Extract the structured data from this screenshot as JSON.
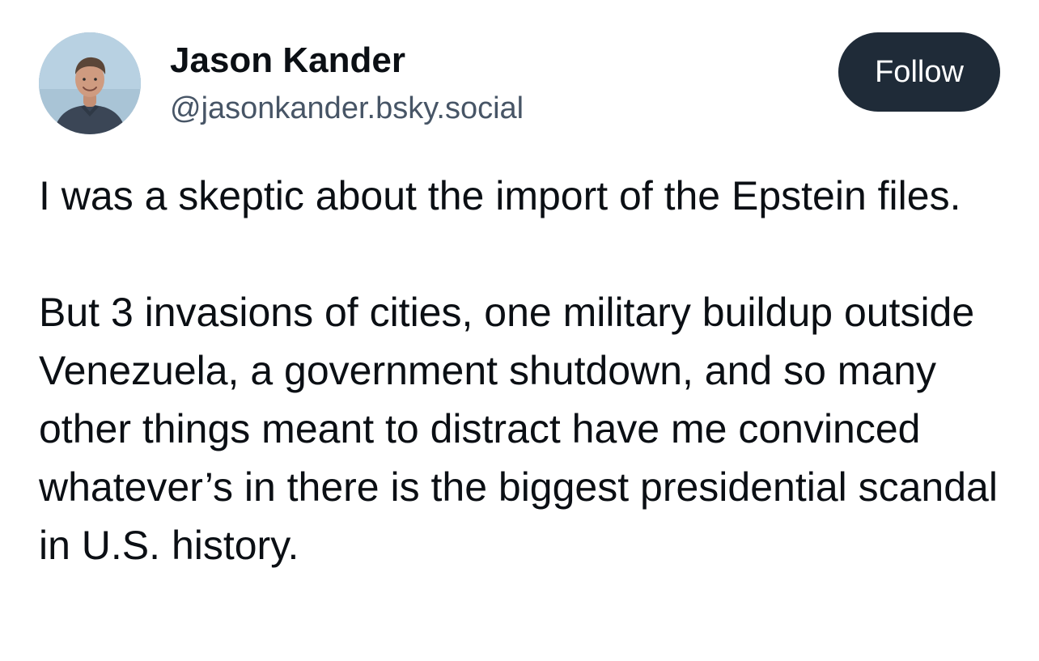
{
  "author": {
    "display_name": "Jason Kander",
    "handle": "@jasonkander.bsky.social"
  },
  "actions": {
    "follow_label": "Follow"
  },
  "post": {
    "paragraphs": [
      "I was a skeptic about the import of the Epstein files.",
      "But 3 invasions of cities, one military buildup outside Venezuela, a government shutdown, and so many other things meant to distract have me convinced whatever’s in there is the biggest presidential scandal in U.S. history."
    ]
  },
  "colors": {
    "follow_button_bg": "#1f2b38",
    "handle_text": "#475566",
    "body_text": "#0b0f14"
  }
}
